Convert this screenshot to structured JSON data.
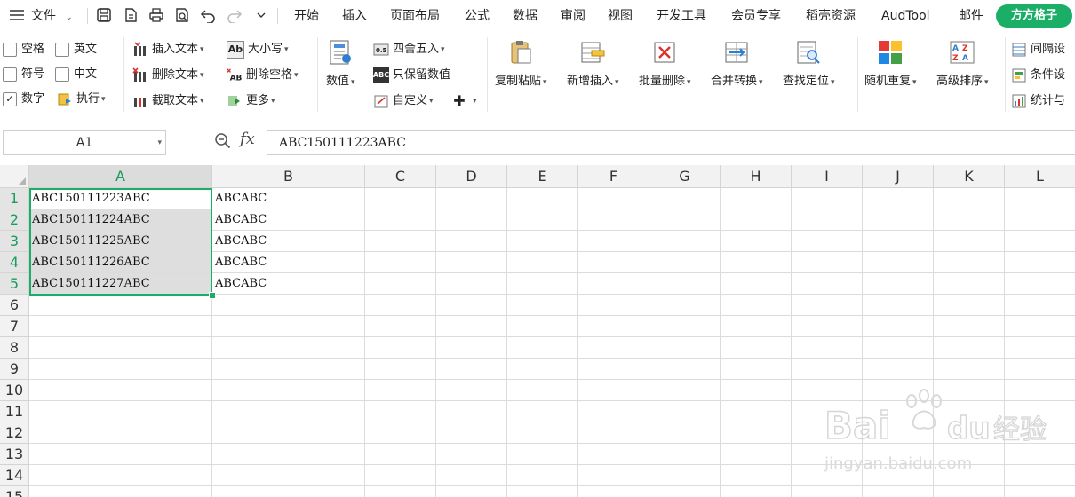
{
  "menubar": {
    "file_label": "文件",
    "tabs": [
      "开始",
      "插入",
      "页面布局",
      "公式",
      "数据",
      "审阅",
      "视图",
      "开发工具",
      "会员专享",
      "稻壳资源",
      "AudTool",
      "邮件"
    ],
    "active_tab": "方方格子"
  },
  "ribbon": {
    "checkboxes": [
      {
        "label": "空格",
        "checked": false
      },
      {
        "label": "英文",
        "checked": false
      },
      {
        "label": "符号",
        "checked": false
      },
      {
        "label": "中文",
        "checked": false
      },
      {
        "label": "数字",
        "checked": true
      }
    ],
    "execute_label": "执行",
    "insert_text_label": "插入文本",
    "delete_text_label": "删除文本",
    "cut_text_label": "截取文本",
    "case_label": "大小写",
    "delete_space_label": "删除空格",
    "more_label": "更多",
    "numeric_label": "数值",
    "round_label": "四舍五入",
    "keep_numeric_label": "只保留数值",
    "custom_label": "自定义",
    "copy_paste_label": "复制粘贴",
    "new_insert_label": "新增插入",
    "batch_delete_label": "批量删除",
    "merge_convert_label": "合并转换",
    "find_locate_label": "查找定位",
    "random_repeat_label": "随机重复",
    "advanced_sort_label": "高级排序",
    "interval_setting_label": "间隔设",
    "condition_setting_label": "条件设",
    "statistics_label": "统计与"
  },
  "formula_bar": {
    "name_box": "A1",
    "fx": "fx",
    "formula": "ABC150111223ABC"
  },
  "grid": {
    "columns": [
      "A",
      "B",
      "C",
      "D",
      "E",
      "F",
      "G",
      "H",
      "I",
      "J",
      "K",
      "L"
    ],
    "selected_column": "A",
    "rows": [
      "1",
      "2",
      "3",
      "4",
      "5",
      "6",
      "7",
      "8",
      "9",
      "10",
      "11",
      "12",
      "13",
      "14",
      "15"
    ],
    "column_a": [
      "ABC150111223ABC",
      "ABC150111224ABC",
      "ABC150111225ABC",
      "ABC150111226ABC",
      "ABC150111227ABC"
    ],
    "column_b": [
      "ABCABC",
      "ABCABC",
      "ABCABC",
      "ABCABC",
      "ABCABC"
    ]
  },
  "watermark": {
    "brand": "Bai du 经验",
    "url": "jingyan.baidu.com"
  },
  "colors": {
    "accent_green": "#1aae66",
    "selection_fill": "#dedede",
    "header_fill": "#f2f2f2"
  }
}
